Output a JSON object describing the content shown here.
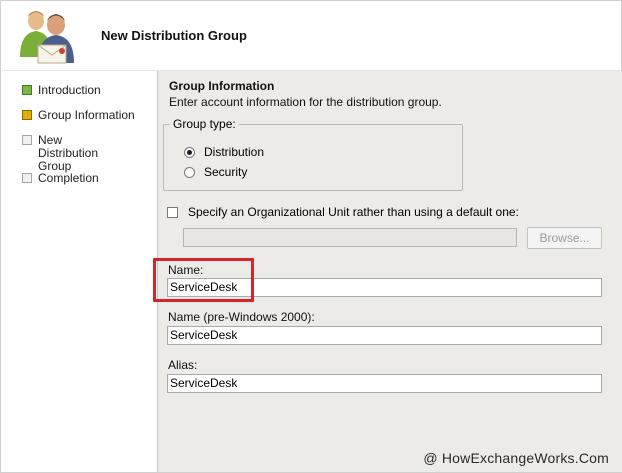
{
  "wizard": {
    "title": "New Distribution Group",
    "icon": "users-group-icon"
  },
  "nav": {
    "items": [
      {
        "label": "Introduction",
        "state": "done"
      },
      {
        "label": "Group Information",
        "state": "current"
      },
      {
        "label": "New Distribution Group",
        "state": "pending"
      },
      {
        "label": "Completion",
        "state": "pending"
      }
    ]
  },
  "section": {
    "title": "Group Information",
    "description": "Enter account information for the distribution group."
  },
  "group_type": {
    "legend": "Group type:",
    "options": [
      {
        "label": "Distribution",
        "checked": true
      },
      {
        "label": "Security",
        "checked": false
      }
    ]
  },
  "ou": {
    "checkbox_label": "Specify an Organizational Unit rather than using a default one:",
    "checked": false,
    "value": "",
    "browse_label": "Browse..."
  },
  "fields": {
    "name_label": "Name:",
    "name_value": "ServiceDesk",
    "pre2000_label": "Name (pre-Windows 2000):",
    "pre2000_value": "ServiceDesk",
    "alias_label": "Alias:",
    "alias_value": "ServiceDesk"
  },
  "watermark": "@ HowExchangeWorks.Com",
  "colors": {
    "highlight": "#d8232a",
    "content_bg": "#ecebe8",
    "done": "#7ab648",
    "current": "#e0b000"
  }
}
